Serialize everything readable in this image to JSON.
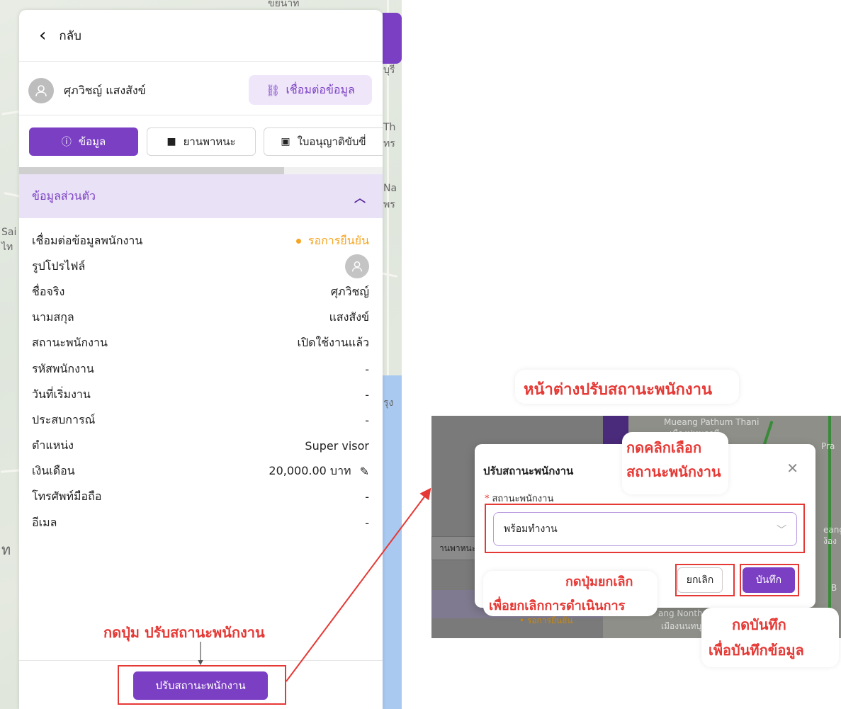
{
  "panel": {
    "back_label": "กลับ",
    "user_name": "ศุภวิชญ์ แสงสังข์",
    "link_button": "เชื่อมต่อข้อมูล",
    "tabs": [
      {
        "label": "ข้อมูล",
        "icon": "info-icon"
      },
      {
        "label": "ยานพาหนะ",
        "icon": "truck-icon"
      },
      {
        "label": "ใบอนุญาติขับขี่",
        "icon": "id-card-icon"
      }
    ],
    "section_title": "ข้อมูลส่วนตัว",
    "rows": [
      {
        "label": "เชื่อมต่อข้อมูลพนักงาน",
        "value": "รอการยืนยัน"
      },
      {
        "label": "รูปโปรไฟล์",
        "value": ""
      },
      {
        "label": "ชื่อจริง",
        "value": "ศุภวิชญ์"
      },
      {
        "label": "นามสกุล",
        "value": "แสงสังข์"
      },
      {
        "label": "สถานะพนักงาน",
        "value": "เปิดใช้งานแล้ว"
      },
      {
        "label": "รหัสพนักงาน",
        "value": "-"
      },
      {
        "label": "วันที่เริ่มงาน",
        "value": "-"
      },
      {
        "label": "ประสบการณ์",
        "value": "-"
      },
      {
        "label": "ตำแหน่ง",
        "value": "Super visor"
      },
      {
        "label": "เงินเดือน",
        "value": "20,000.00 บาท"
      },
      {
        "label": "โทรศัพท์มือถือ",
        "value": "-"
      },
      {
        "label": "อีเมล",
        "value": "-"
      }
    ],
    "adjust_button": "ปรับสถานะพนักงาน"
  },
  "modal": {
    "title": "ปรับสถานะพนักงาน",
    "field_label": "สถานะพนักงาน",
    "selected_value": "พร้อมทำงาน",
    "cancel_label": "ยกเลิก",
    "save_label": "บันทึก",
    "background_tab": "านพาหนะ"
  },
  "map_labels": {
    "left": [
      "ขยนาท",
      "บุรี",
      "Th",
      "ทร",
      "Na",
      "พร",
      "Sai",
      "ไท",
      "รุง",
      "ท"
    ],
    "shot": [
      "Mueang Pathum Thani",
      "เมืองปทุมธานี",
      "Pra",
      "eang",
      "ง้อง",
      "B",
      "ang Nonthab",
      "เมืองนนทบุรี",
      "• รอการยืนยัน"
    ]
  },
  "annotations": {
    "window_title": "หน้าต่างปรับสถานะพนักงาน",
    "click_select_1": "กดคลิกเลือก",
    "click_select_2": "สถานะพนักงาน",
    "cancel_1": "กดปุ่มยกเลิก",
    "cancel_2": "เพื่อยกเลิกการดำเนินการ",
    "save_1": "กดบันทึก",
    "save_2": "เพื่อบันทึกข้อมูล",
    "press_adjust": "กดปุ่ม ปรับสถานะพนักงาน"
  },
  "colors": {
    "primary": "#7b3fc4",
    "pending": "#f5a623",
    "annotation": "#e53935"
  }
}
